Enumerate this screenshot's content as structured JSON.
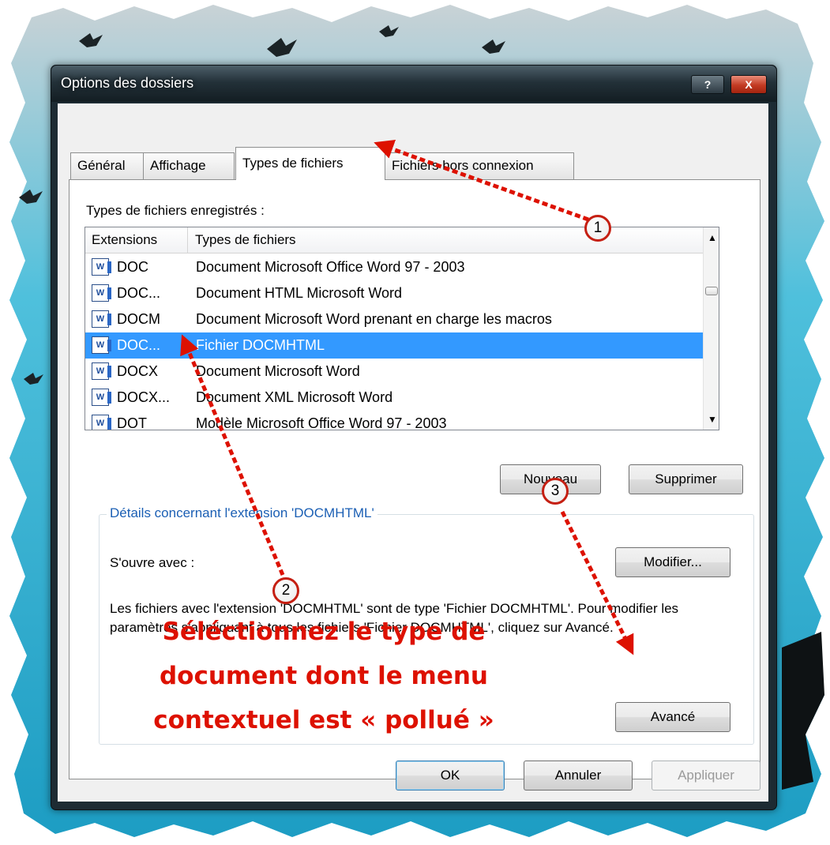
{
  "window": {
    "title": "Options des dossiers",
    "help_label": "?",
    "close_label": "X"
  },
  "tabs": [
    {
      "label": "Général"
    },
    {
      "label": "Affichage"
    },
    {
      "label": "Types de fichiers",
      "active": true
    },
    {
      "label": "Fichiers hors connexion"
    }
  ],
  "registered_label": "Types de fichiers enregistrés :",
  "list": {
    "columns": [
      "Extensions",
      "Types de fichiers"
    ],
    "rows": [
      {
        "ext": "DOC",
        "type": "Document Microsoft Office Word 97 - 2003",
        "icon": "word-document-icon"
      },
      {
        "ext": "DOC...",
        "type": "Document HTML Microsoft Word",
        "icon": "word-html-icon"
      },
      {
        "ext": "DOCM",
        "type": "Document Microsoft Word prenant en charge les macros",
        "icon": "word-macro-icon"
      },
      {
        "ext": "DOC...",
        "type": "Fichier DOCMHTML",
        "icon": "word-document-icon",
        "selected": true
      },
      {
        "ext": "DOCX",
        "type": "Document Microsoft Word",
        "icon": "word-document-icon"
      },
      {
        "ext": "DOCX...",
        "type": "Document XML Microsoft Word",
        "icon": "word-xml-icon"
      },
      {
        "ext": "DOT",
        "type": "Modèle Microsoft Office Word 97 - 2003",
        "icon": "word-template-icon"
      }
    ]
  },
  "buttons": {
    "new": "Nouveau",
    "delete": "Supprimer",
    "modify": "Modifier...",
    "advanced": "Avancé",
    "ok": "OK",
    "cancel": "Annuler",
    "apply": "Appliquer"
  },
  "details": {
    "group_title": "Détails concernant l'extension 'DOCMHTML'",
    "opens_with": "S'ouvre avec :",
    "description": "Les fichiers avec l'extension 'DOCMHTML' sont de type 'Fichier DOCMHTML'. Pour modifier les paramètres s'appliquant à tous les fichiers 'Fichier DOCMHTML', cliquez sur Avancé."
  },
  "annotation": {
    "lines": [
      "Séléctionnez le type de",
      "document dont le menu",
      "contextuel est « pollué »"
    ],
    "badges": [
      "1",
      "2",
      "3"
    ],
    "color": "#dd1100"
  },
  "colors": {
    "selection": "#3399ff",
    "frame": "#1d2b33",
    "group_title": "#1b5fb4",
    "backdrop": "#33b6d3"
  }
}
